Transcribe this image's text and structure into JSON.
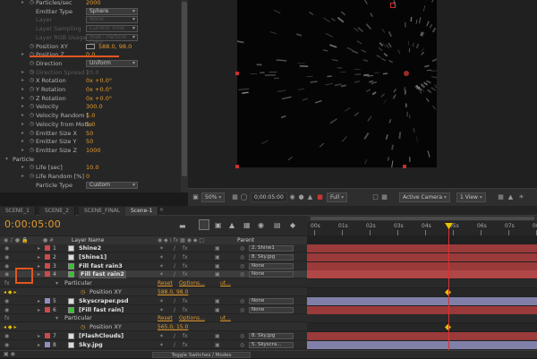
{
  "effect_controls": {
    "rows": [
      {
        "label": "Particles/sec",
        "value": "2000",
        "indent": 1,
        "twirl": true,
        "stopwatch": true
      },
      {
        "label": "Emitter Type",
        "select": "Sphere",
        "indent": 1
      },
      {
        "label": "Layer",
        "select": "None",
        "indent": 1,
        "dim": true
      },
      {
        "label": "Layer Sampling",
        "select": "Current Time",
        "indent": 1,
        "dim": true
      },
      {
        "label": "Layer RGB Usage",
        "select": "RGB - Particle Color",
        "indent": 1,
        "dim": true
      },
      {
        "label": "Position XY",
        "value": "588.0, 98.0",
        "indent": 1,
        "stopwatch": true,
        "highlight": true
      },
      {
        "label": "Position Z",
        "value": "0.0",
        "indent": 1,
        "twirl": true,
        "stopwatch": true
      },
      {
        "label": "Direction",
        "select": "Uniform",
        "indent": 1,
        "stopwatch": true
      },
      {
        "label": "Direction Spread [",
        "value": "20.0",
        "indent": 1,
        "twirl": true,
        "stopwatch": true,
        "dim": true
      },
      {
        "label": "X Rotation",
        "value": "0x +0.0°",
        "indent": 1,
        "twirl": true,
        "stopwatch": true
      },
      {
        "label": "Y Rotation",
        "value": "0x +0.0°",
        "indent": 1,
        "twirl": true,
        "stopwatch": true
      },
      {
        "label": "Z Rotation",
        "value": "0x +0.0°",
        "indent": 1,
        "twirl": true,
        "stopwatch": true
      },
      {
        "label": "Velocity",
        "value": "300.0",
        "indent": 1,
        "twirl": true,
        "stopwatch": true
      },
      {
        "label": "Velocity Random [",
        "value": "5.0",
        "indent": 1,
        "twirl": true,
        "stopwatch": true
      },
      {
        "label": "Velocity from Motio",
        "value": "5.0",
        "indent": 1,
        "twirl": true,
        "stopwatch": true
      },
      {
        "label": "Emitter Size X",
        "value": "50",
        "indent": 1,
        "twirl": true,
        "stopwatch": true
      },
      {
        "label": "Emitter Size Y",
        "value": "50",
        "indent": 1,
        "twirl": true,
        "stopwatch": true
      },
      {
        "label": "Emitter Size Z",
        "value": "1000",
        "indent": 1,
        "twirl": true,
        "stopwatch": true
      },
      {
        "label": "Particle",
        "group": true,
        "indent": 0
      },
      {
        "label": "Life [sec]",
        "value": "10.0",
        "indent": 1,
        "twirl": true,
        "stopwatch": true
      },
      {
        "label": "Life Random [%]",
        "value": "0",
        "indent": 1,
        "twirl": true,
        "stopwatch": true
      },
      {
        "label": "Particle Type",
        "select": "Custom",
        "indent": 1
      }
    ]
  },
  "viewer": {
    "zoom": "50%",
    "timecode": "0;00:05:00",
    "resolution": "Full",
    "camera": "Active Camera",
    "view": "1 View"
  },
  "tabs": [
    "SCENE_1",
    "SCENE_2",
    "SCENE_FINAL",
    "Scene-1"
  ],
  "active_tab": "Scene-1",
  "timeline": {
    "timecode": "0:00:05:00",
    "ruler": [
      "00s",
      "01s",
      "02s",
      "03s",
      "04s",
      "05s",
      "06s",
      "07s",
      "08s"
    ],
    "header": {
      "layer_name": "Layer Name",
      "parent": "Parent"
    },
    "layers": [
      {
        "num": "1",
        "name": "Shine2",
        "label_color": "#c94b4b",
        "parent": "2. Shine1",
        "track_color": "#9b3a3a"
      },
      {
        "num": "2",
        "name": "[Shine1]",
        "label_color": "#c94b4b",
        "parent": "8. Sky.jpg",
        "track_color": "#9b3a3a"
      },
      {
        "num": "3",
        "name": "Fill fast rain3",
        "label_color": "#c94b4b",
        "parent": "None",
        "track_color": "#9b3a3a",
        "icon_color": "#39c234"
      },
      {
        "num": "4",
        "name": "Fill fast rain2",
        "label_color": "#c94b4b",
        "parent": "None",
        "track_color": "#b84848",
        "icon_color": "#39c234",
        "selected": true
      },
      {
        "sub": true,
        "name": "Particular",
        "reset": "Reset",
        "options": "Options...",
        "extra": "ut..."
      },
      {
        "sub": true,
        "prop": true,
        "name": "Position XY",
        "value": "588.0, 98.0"
      },
      {
        "num": "5",
        "name": "Skyscraper.psd",
        "label_color": "#8f8fc2",
        "parent": "None",
        "track_color": "#7f7fa8"
      },
      {
        "num": "6",
        "name": "[Fill fast rain]",
        "label_color": "#c94b4b",
        "parent": "None",
        "track_color": "#9b3a3a",
        "icon_color": "#39c234"
      },
      {
        "sub": true,
        "name": "Particular",
        "reset": "Reset",
        "options": "Options...",
        "extra": "ut..."
      },
      {
        "sub": true,
        "prop": true,
        "name": "Position XY",
        "value": "565.0, 15.0"
      },
      {
        "num": "7",
        "name": "[FlashClouds]",
        "label_color": "#c94b4b",
        "parent": "8. Sky.jpg",
        "track_color": "#9b3a3a"
      },
      {
        "num": "8",
        "name": "Sky.jpg",
        "label_color": "#8f8fc2",
        "parent": "5. Skyscra...",
        "track_color": "#7f7fa8"
      }
    ],
    "toggle": "Toggle Switches / Modes"
  },
  "colors": {
    "accent": "#e39b2c",
    "highlight_box": "#e2561f",
    "playhead": "#e03030"
  }
}
